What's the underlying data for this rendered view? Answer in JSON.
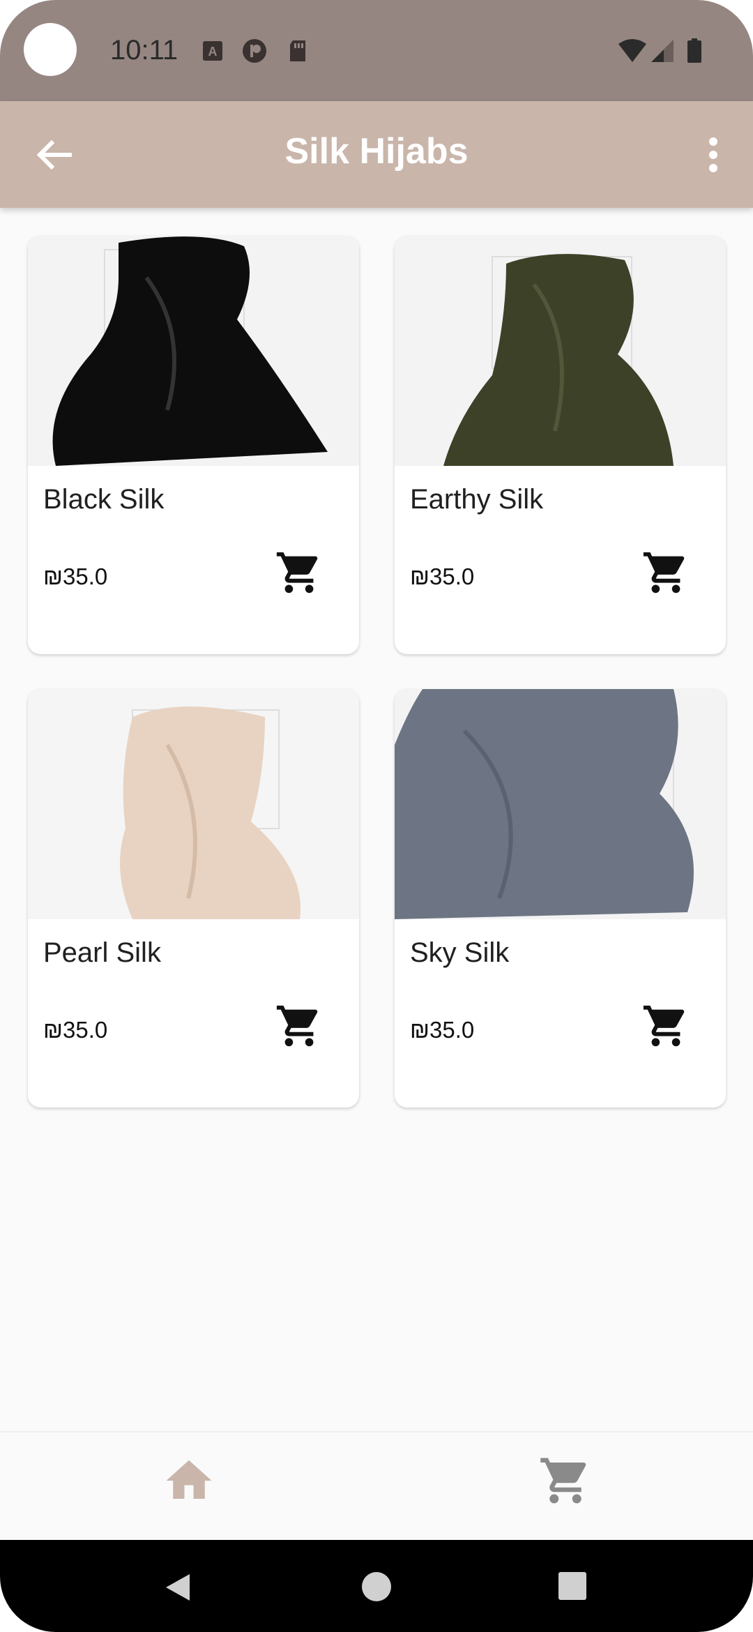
{
  "status_bar": {
    "time": "10:11",
    "icons": [
      "a-icon",
      "circle-p-icon",
      "sd-card-icon",
      "wifi-icon",
      "signal-icon",
      "battery-icon"
    ]
  },
  "app_bar": {
    "title": "Silk Hijabs",
    "back_icon": "arrow-back-icon",
    "menu_icon": "more-vert-icon"
  },
  "products": [
    {
      "name": "Black Silk",
      "price": "₪35.0",
      "image_color": "#0d0d0d"
    },
    {
      "name": "Earthy Silk",
      "price": "₪35.0",
      "image_color": "#3d4128"
    },
    {
      "name": "Pearl Silk",
      "price": "₪35.0",
      "image_color": "#e8d3c2"
    },
    {
      "name": "Sky Silk",
      "price": "₪35.0",
      "image_color": "#6d7584"
    }
  ],
  "bottom_nav": {
    "items": [
      {
        "icon": "home-icon",
        "color": "#c9b5aa"
      },
      {
        "icon": "cart-icon",
        "color": "#8a8a8a"
      }
    ]
  },
  "colors": {
    "status_bar": "#958681",
    "app_bar": "#c9b5aa",
    "background": "#fafafa"
  }
}
